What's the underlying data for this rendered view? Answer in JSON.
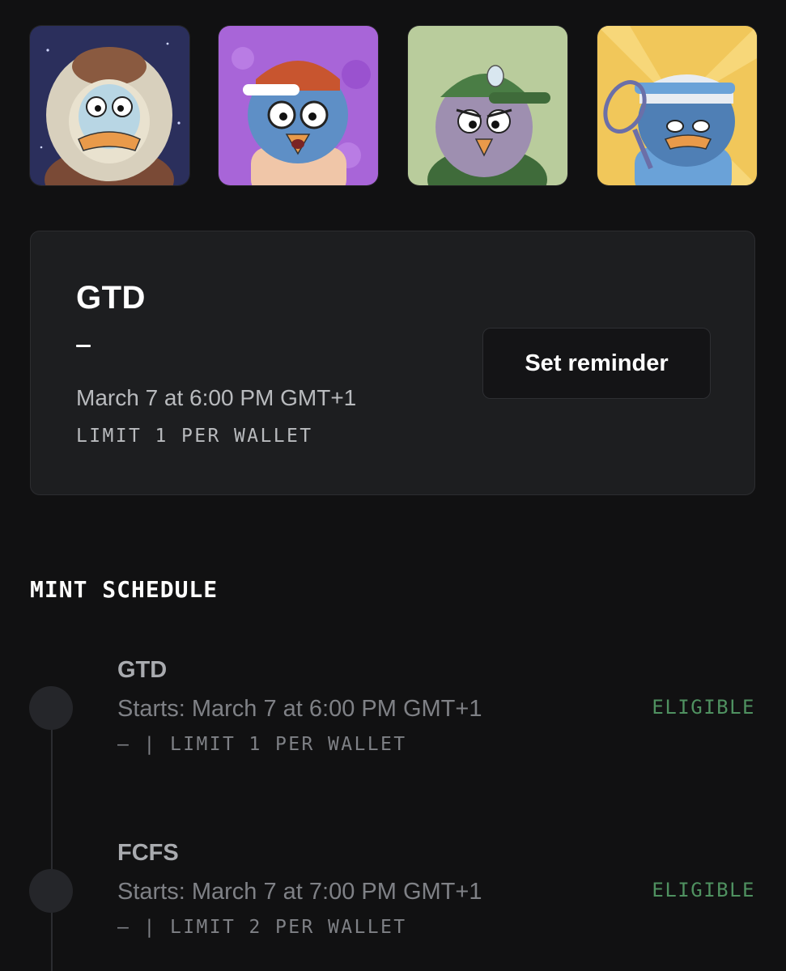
{
  "collection": {
    "thumbnails": [
      {
        "icon": "penguin-in-fur-hood-image",
        "background": "#2b2f5c"
      },
      {
        "icon": "penguin-in-backwards-cap-image",
        "background": "#a865d8"
      },
      {
        "icon": "penguin-in-green-cap-image",
        "background": "#b9cc9c"
      },
      {
        "icon": "penguin-with-tennis-racket-image",
        "background": "#f1c75a"
      }
    ]
  },
  "active_phase": {
    "title": "GTD",
    "price": "–",
    "date": "March 7 at 6:00 PM GMT+1",
    "limit": "LIMIT 1 PER WALLET",
    "reminder_label": "Set reminder"
  },
  "schedule": {
    "heading": "MINT SCHEDULE",
    "phases": [
      {
        "name": "GTD",
        "start": "Starts: March 7 at 6:00 PM GMT+1",
        "meta": "– | LIMIT 1 PER WALLET",
        "status": "ELIGIBLE"
      },
      {
        "name": "FCFS",
        "start": "Starts: March 7 at 7:00 PM GMT+1",
        "meta": "– | LIMIT 2 PER WALLET",
        "status": "ELIGIBLE"
      }
    ]
  },
  "colors": {
    "background": "#111112",
    "card": "#1d1e20",
    "eligible": "#4f9160"
  }
}
